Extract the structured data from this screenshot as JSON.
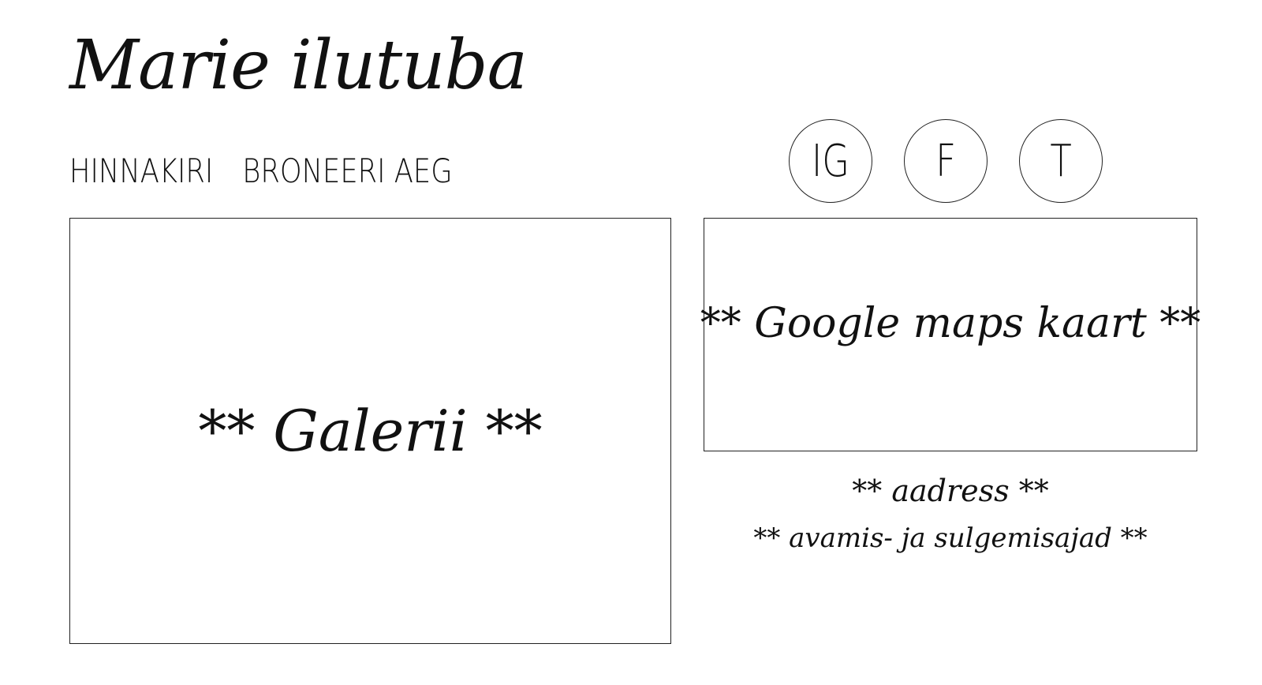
{
  "header": {
    "brand_title": "Marie ilutuba"
  },
  "nav": {
    "items": [
      {
        "label": "HINNAKIRI"
      },
      {
        "label": "BRONEERI AEG"
      }
    ]
  },
  "social": {
    "items": [
      {
        "label": "IG",
        "icon": "instagram-icon"
      },
      {
        "label": "F",
        "icon": "facebook-icon"
      },
      {
        "label": "T",
        "icon": "twitter-icon"
      }
    ]
  },
  "gallery": {
    "placeholder": "** Galerii **"
  },
  "map": {
    "placeholder": "** Google maps kaart **"
  },
  "info": {
    "address": "** aadress **",
    "hours": "** avamis- ja sulgemisajad **"
  }
}
